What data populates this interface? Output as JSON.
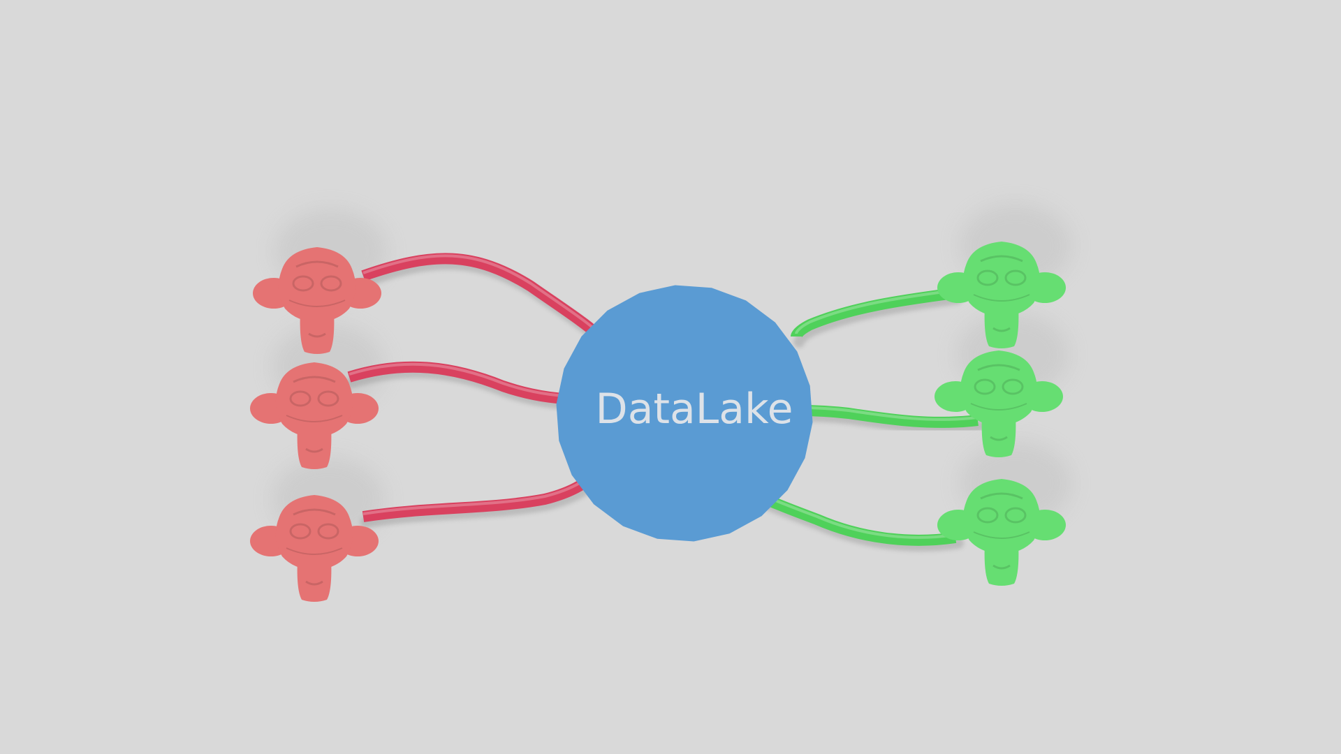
{
  "hub": {
    "label": "DataLake",
    "fill_color": "#5a9bd3",
    "label_color": "#dde2e8"
  },
  "producers": {
    "count": 3,
    "body_color": "#e57373",
    "pipe_color": "#d9415f",
    "icon": "monkey-head-icon"
  },
  "consumers": {
    "count": 3,
    "body_color": "#66de72",
    "pipe_color": "#4fd15a",
    "icon": "monkey-head-icon"
  },
  "background_color": "#d9d9d9"
}
